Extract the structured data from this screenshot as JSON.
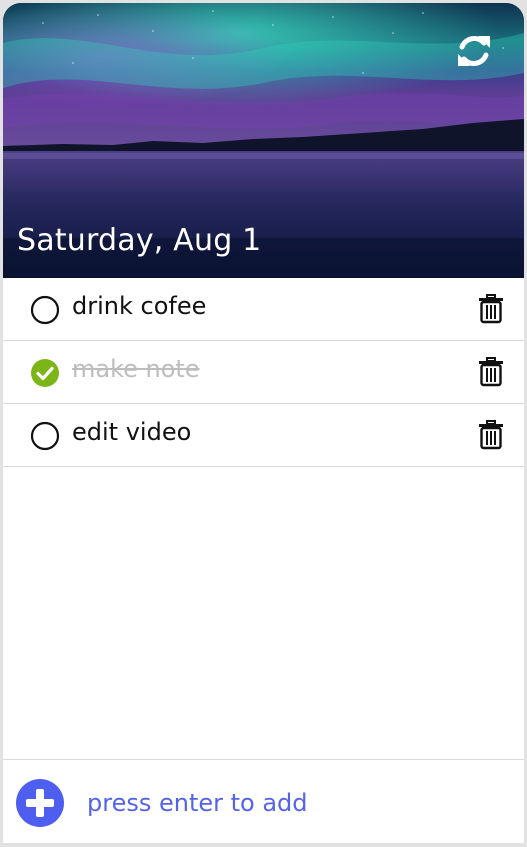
{
  "header": {
    "date": "Saturday, Aug 1",
    "refresh_icon": "refresh-icon"
  },
  "tasks": [
    {
      "text": "drink cofee",
      "done": false
    },
    {
      "text": "make note",
      "done": true
    },
    {
      "text": "edit video",
      "done": false
    }
  ],
  "footer": {
    "add_icon": "plus-circle-icon",
    "placeholder": "press enter to add"
  },
  "colors": {
    "accent": "#4e5ff0",
    "done_check": "#7cb518",
    "done_text": "#bdbdbd"
  }
}
